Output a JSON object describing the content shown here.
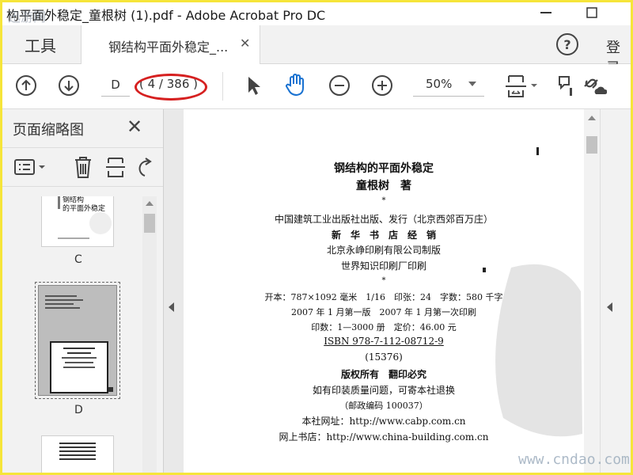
{
  "window": {
    "title": "构平面外稳定_童根树 (1).pdf - Adobe Acrobat Pro DC",
    "logo_watermark": "迅游网"
  },
  "tabs": {
    "tools": "工具",
    "doc": "钢结构平面外稳定_...",
    "signin": "登录"
  },
  "toolbar": {
    "page_value": "D",
    "page_count": "( 4 / 386 )",
    "zoom": "50%"
  },
  "sidebar": {
    "title": "页面缩略图",
    "thumbs": [
      {
        "label": "C",
        "title_line1": "钢结构",
        "title_line2": "的平面外稳定"
      },
      {
        "label": "D"
      }
    ]
  },
  "page": {
    "lines": [
      "钢结构的平面外稳定",
      "童根树　著",
      "*",
      "中国建筑工业出版社出版、发行（北京西郊百万庄）",
      "新　华　书　店　经　销",
      "北京永峥印刷有限公司制版",
      "世界知识印刷厂印刷",
      "*",
      "开本：787×1092 毫米　1/16　印张：24　字数：580 千字",
      "2007 年 1 月第一版　2007 年 1 月第一次印刷",
      "印数：1—3000 册　定价：46.00 元",
      "ISBN 978-7-112-08712-9",
      "(15376)",
      "版权所有　翻印必究",
      "如有印装质量问题，可寄本社退换",
      "（邮政编码 100037）",
      "本社网址：http://www.cabp.com.cn",
      "网上书店：http://www.china-building.com.cn"
    ]
  },
  "watermark": "www.cndao.com"
}
